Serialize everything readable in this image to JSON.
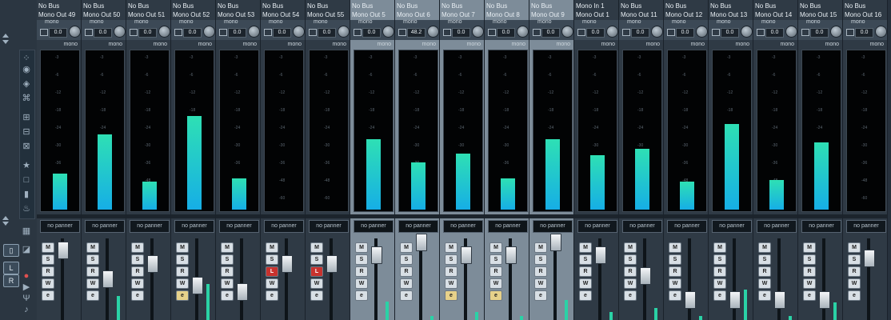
{
  "channels": [
    {
      "line1": "No Bus",
      "line2": "Mono Out 49",
      "gain": "0.0",
      "meter": 0.23,
      "fader": 0.12,
      "sel": false,
      "mode": "none",
      "level": 0
    },
    {
      "line1": "No Bus",
      "line2": "Mono Out 50",
      "gain": "0.0",
      "meter": 0.48,
      "fader": 0.57,
      "sel": false,
      "mode": "none",
      "level": 0.3
    },
    {
      "line1": "No Bus",
      "line2": "Mono Out 51",
      "gain": "0.0",
      "meter": 0.18,
      "fader": 0.34,
      "sel": false,
      "mode": "none",
      "level": 0
    },
    {
      "line1": "No Bus",
      "line2": "Mono Out 52",
      "gain": "0.0",
      "meter": 0.6,
      "fader": 0.67,
      "sel": false,
      "mode": "yellow",
      "level": 0.45
    },
    {
      "line1": "No Bus",
      "line2": "Mono Out 53",
      "gain": "0.0",
      "meter": 0.2,
      "fader": 0.78,
      "sel": false,
      "mode": "none",
      "level": 0
    },
    {
      "line1": "No Bus",
      "line2": "Mono Out 54",
      "gain": "0.0",
      "meter": 0,
      "fader": 0.34,
      "sel": false,
      "mode": "red",
      "level": 0
    },
    {
      "line1": "No Bus",
      "line2": "Mono Out 55",
      "gain": "0.0",
      "meter": 0,
      "fader": 0.34,
      "sel": false,
      "mode": "red",
      "level": 0
    },
    {
      "line1": "No Bus",
      "line2": "Mono Out 5",
      "gain": "0.0",
      "meter": 0.45,
      "fader": 0.2,
      "sel": true,
      "mode": "none",
      "level": 0.23
    },
    {
      "line1": "No Bus",
      "line2": "Mono Out 6",
      "gain": "48.2",
      "meter": 0.3,
      "fader": 0.0,
      "sel": true,
      "mode": "none",
      "level": 0.05
    },
    {
      "line1": "No Bus",
      "line2": "Mono Out 7",
      "gain": "0.0",
      "meter": 0.36,
      "fader": 0.2,
      "sel": true,
      "mode": "yellow",
      "level": 0.1
    },
    {
      "line1": "No Bus",
      "line2": "Mono Out 8",
      "gain": "0.0",
      "meter": 0.2,
      "fader": 0.2,
      "sel": true,
      "mode": "yellow",
      "level": 0.05
    },
    {
      "line1": "No Bus",
      "line2": "Mono Out 9",
      "gain": "0.0",
      "meter": 0.45,
      "fader": 0.0,
      "sel": true,
      "mode": "none",
      "level": 0.25
    },
    {
      "line1": "Mono In 1",
      "line2": "Mono Out 1",
      "gain": "0.0",
      "meter": 0.35,
      "fader": 0.2,
      "sel": false,
      "mode": "none",
      "level": 0.1
    },
    {
      "line1": "No Bus",
      "line2": "Mono Out 11",
      "gain": "0.0",
      "meter": 0.39,
      "fader": 0.52,
      "sel": false,
      "mode": "none",
      "level": 0.15
    },
    {
      "line1": "No Bus",
      "line2": "Mono Out 12",
      "gain": "0.0",
      "meter": 0.18,
      "fader": 0.9,
      "sel": false,
      "mode": "none",
      "level": 0.05
    },
    {
      "line1": "No Bus",
      "line2": "Mono Out 13",
      "gain": "0.0",
      "meter": 0.55,
      "fader": 0.9,
      "sel": false,
      "mode": "none",
      "level": 0.38
    },
    {
      "line1": "No Bus",
      "line2": "Mono Out 14",
      "gain": "0.0",
      "meter": 0.19,
      "fader": 0.9,
      "sel": false,
      "mode": "none",
      "level": 0.05
    },
    {
      "line1": "No Bus",
      "line2": "Mono Out 15",
      "gain": "0.0",
      "meter": 0.43,
      "fader": 0.9,
      "sel": false,
      "mode": "none",
      "level": 0.22
    },
    {
      "line1": "No Bus",
      "line2": "Mono Out 16",
      "gain": "0.0",
      "meter": 0,
      "fader": 0.25,
      "sel": false,
      "mode": "none",
      "level": 0
    }
  ],
  "strip_texts": {
    "mono": "mono",
    "pan": "no panner",
    "m": "M",
    "s": "S",
    "r": "R",
    "w": "W",
    "e": "e",
    "l": "L"
  },
  "scale_ticks": [
    "-3",
    "-6",
    "-12",
    "-18",
    "-24",
    "-30",
    "-36",
    "-48",
    "-60"
  ],
  "colors": {
    "meter_top": "#2ee0b4",
    "meter_bottom": "#16aee6",
    "selected_strip": "#7d8c99",
    "strip": "#2f3a45",
    "mute_red": "#c8322e"
  },
  "left_icons": [
    "link-icon",
    "expand-icon",
    "collapse-icon",
    "connect-icon",
    "routing-icon",
    "star-icon",
    "square-icon",
    "meter-icon",
    "tuner-icon"
  ]
}
